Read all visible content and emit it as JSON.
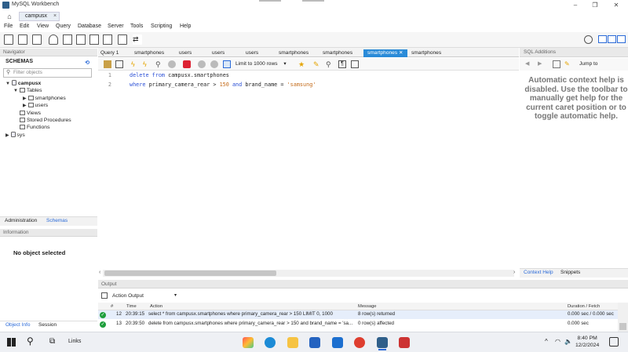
{
  "window": {
    "title": "MySQL Workbench",
    "min": "–",
    "max": "❐",
    "close": "✕"
  },
  "connection_tab": {
    "label": "campusx",
    "close": "×"
  },
  "menu": [
    "File",
    "Edit",
    "View",
    "Query",
    "Database",
    "Server",
    "Tools",
    "Scripting",
    "Help"
  ],
  "navigator": {
    "header": "Navigator",
    "schemas_label": "SCHEMAS",
    "filter_placeholder": "Filter objects",
    "tree": {
      "db1": "campusx",
      "tables": "Tables",
      "t1": "smartphones",
      "t2": "users",
      "views": "Views",
      "procs": "Stored Procedures",
      "funcs": "Functions",
      "db2": "sys"
    },
    "bottom_tabs": [
      "Administration",
      "Schemas"
    ],
    "info_header": "Information",
    "no_object": "No object selected",
    "obj_tabs": [
      "Object Info",
      "Session"
    ]
  },
  "query_tabs": [
    "Query 1",
    "smartphones",
    "users",
    "users",
    "users",
    "smartphones",
    "smartphones",
    "smartphones",
    "smartphones"
  ],
  "active_tab_index": 7,
  "limit_select": "Limit to 1000 rows",
  "editor": {
    "lines": [
      "1",
      "2"
    ],
    "line1": {
      "kw1": "delete",
      "kw2": "from",
      "rest": "campusx.smartphones"
    },
    "line2": {
      "kw1": "where",
      "col": "primary_camera_rear",
      "op": ">",
      "num": "150",
      "kw2": "and",
      "col2": "brand_name",
      "eq": "=",
      "str": "'samsung'"
    }
  },
  "sql_additions": {
    "header": "SQL Additions",
    "jump_to": "Jump to",
    "help": "Automatic context help is disabled. Use the toolbar to manually get help for the current caret position or to toggle automatic help.",
    "tabs": [
      "Context Help",
      "Snippets"
    ]
  },
  "output": {
    "header": "Output",
    "mode": "Action Output",
    "columns": [
      "#",
      "Time",
      "Action",
      "Message",
      "Duration / Fetch"
    ],
    "rows": [
      {
        "num": "12",
        "time": "20:39:15",
        "action": "select * from campusx.smartphones where primary_camera_rear > 150 LIMIT 0, 1000",
        "message": "8 row(s) returned",
        "duration": "0.000 sec / 0.000 sec"
      },
      {
        "num": "13",
        "time": "20:39:50",
        "action": "delete from campusx.smartphones where primary_camera_rear > 150 and brand_name = 'sa...",
        "message": "0 row(s) affected",
        "duration": "0.000 sec"
      }
    ]
  },
  "taskbar": {
    "links_label": "Links",
    "time": "8:40 PM",
    "date": "12/2/2024"
  },
  "colors": {
    "accent": "#2a8bd8",
    "ok": "#1e9e3c",
    "keyword": "#2a4fd6",
    "string": "#c46b1a"
  }
}
